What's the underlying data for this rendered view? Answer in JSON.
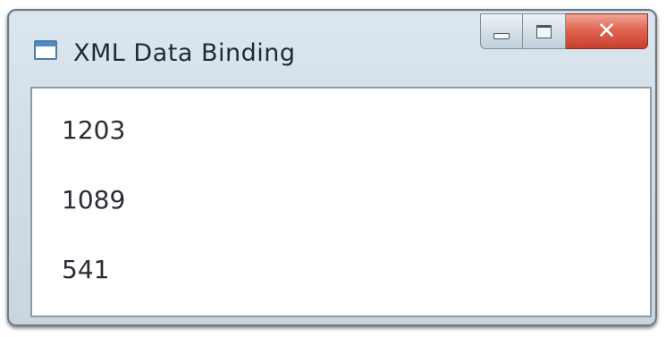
{
  "window": {
    "title": "XML Data Binding",
    "icon": "window-app-icon",
    "controls": {
      "minimize_icon": "minimize-icon",
      "maximize_icon": "maximize-icon",
      "close_icon": "close-icon",
      "close_color": "#d9533f"
    }
  },
  "list": {
    "items": [
      {
        "label": "1203"
      },
      {
        "label": "1089"
      },
      {
        "label": "541"
      }
    ]
  }
}
